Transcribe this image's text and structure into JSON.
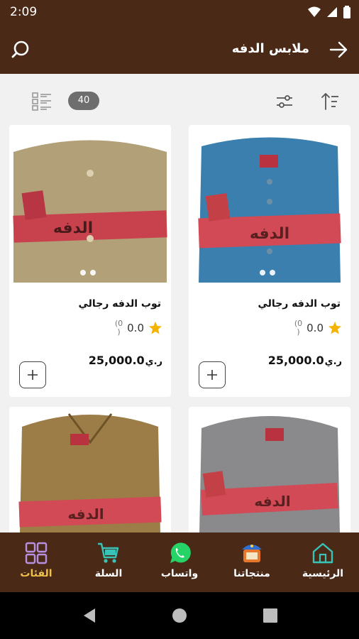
{
  "status_bar": {
    "time": "2:09"
  },
  "app_bar": {
    "title": "ملابس الدفه"
  },
  "toolbar": {
    "count": "40"
  },
  "products": [
    {
      "name": "توب الدفه رجالي",
      "rating": "0.0",
      "review_count": "(0",
      "review_count_close": ")",
      "price": "25,000.0",
      "currency": "ر.ي",
      "shirt_color": "#3b7fae",
      "image_text": "الدفه"
    },
    {
      "name": "توب الدفه رجالي",
      "rating": "0.0",
      "review_count": "(0",
      "review_count_close": ")",
      "price": "25,000.0",
      "currency": "ر.ي",
      "shirt_color": "#b2a178",
      "image_text": "الدفه"
    },
    {
      "name": "",
      "rating": "",
      "review_count": "",
      "review_count_close": "",
      "price": "",
      "currency": "",
      "shirt_color": "#8a8a8c",
      "image_text": "الدفه"
    },
    {
      "name": "",
      "rating": "",
      "review_count": "",
      "review_count_close": "",
      "price": "",
      "currency": "",
      "shirt_color": "#9c7c47",
      "image_text": "الدفه"
    }
  ],
  "bottom_nav": [
    {
      "label": "الرئيسية",
      "icon": "home-icon"
    },
    {
      "label": "منتجاتنا",
      "icon": "store-icon"
    },
    {
      "label": "واتساب",
      "icon": "whatsapp-icon"
    },
    {
      "label": "السلة",
      "icon": "cart-icon"
    },
    {
      "label": "الفئات",
      "icon": "categories-icon"
    }
  ],
  "colors": {
    "brand": "#4a2a17",
    "accent": "#f1c24a",
    "star": "#f5b301"
  }
}
